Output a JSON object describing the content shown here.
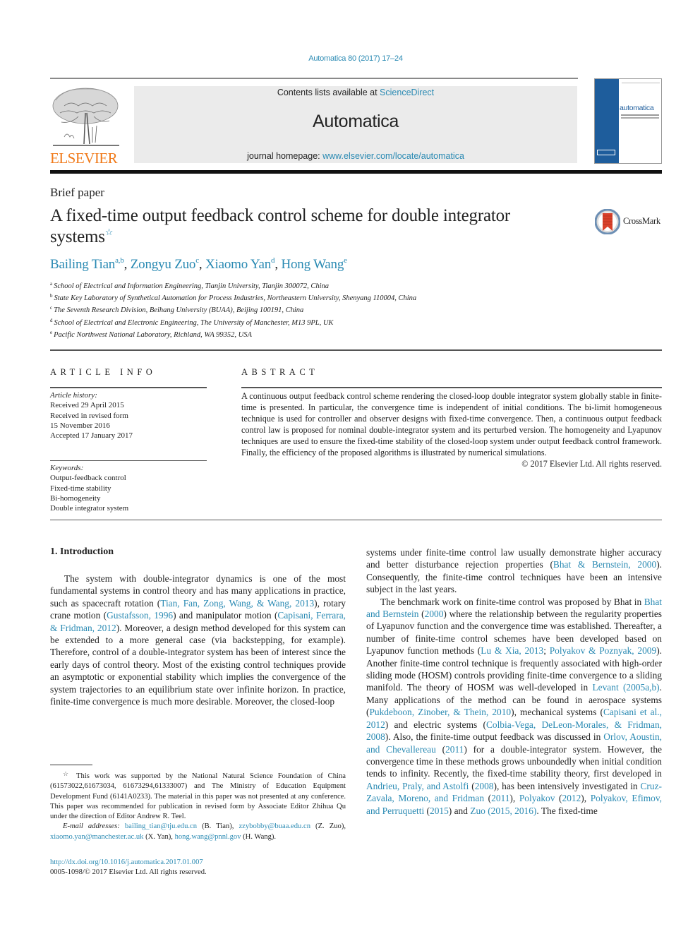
{
  "journal_ref": "Automatica 80 (2017) 17–24",
  "header": {
    "contents_prefix": "Contents lists available at ",
    "contents_link": "ScienceDirect",
    "journal_name": "Automatica",
    "homepage_prefix": "journal homepage: ",
    "homepage_link": "www.elsevier.com/locate/automatica",
    "publisher_logo_text": "ELSEVIER",
    "cover_title": "automatica"
  },
  "article": {
    "type": "Brief paper",
    "title": "A fixed-time output feedback control scheme for double integrator systems",
    "title_note_mark": "☆",
    "crossmark_label": "CrossMark",
    "authors": [
      {
        "name": "Bailing Tian",
        "aff": "a,b"
      },
      {
        "name": "Zongyu Zuo",
        "aff": "c"
      },
      {
        "name": "Xiaomo Yan",
        "aff": "d"
      },
      {
        "name": "Hong Wang",
        "aff": "e"
      }
    ],
    "affiliations": [
      {
        "mark": "a",
        "text": "School of Electrical and Information Engineering, Tianjin University, Tianjin 300072, China"
      },
      {
        "mark": "b",
        "text": "State Key Laboratory of Synthetical Automation for Process Industries, Northeastern University, Shenyang 110004, China"
      },
      {
        "mark": "c",
        "text": "The Seventh Research Division, Beihang University (BUAA), Beijing 100191, China"
      },
      {
        "mark": "d",
        "text": "School of Electrical and Electronic Engineering, The University of Manchester, M13 9PL, UK"
      },
      {
        "mark": "e",
        "text": "Pacific Northwest National Laboratory, Richland, WA 99352, USA"
      }
    ]
  },
  "article_info": {
    "heading": "ARTICLE INFO",
    "history_label": "Article history:",
    "history": [
      "Received 29 April 2015",
      "Received in revised form",
      "15 November 2016",
      "Accepted 17 January 2017"
    ],
    "keywords_label": "Keywords:",
    "keywords": [
      "Output-feedback control",
      "Fixed-time stability",
      "Bi-homogeneity",
      "Double integrator system"
    ]
  },
  "abstract": {
    "heading": "ABSTRACT",
    "text": "A continuous output feedback control scheme rendering the closed-loop double integrator system globally stable in finite-time is presented. In particular, the convergence time is independent of initial conditions. The bi-limit homogeneous technique is used for controller and observer designs with fixed-time convergence. Then, a continuous output feedback control law is proposed for nominal double-integrator system and its perturbed version. The homogeneity and Lyapunov techniques are used to ensure the fixed-time stability of the closed-loop system under output feedback control framework. Finally, the efficiency of the proposed algorithms is illustrated by numerical simulations.",
    "copyright": "© 2017 Elsevier Ltd. All rights reserved."
  },
  "introduction": {
    "heading": "1.  Introduction",
    "left": {
      "t1": "The system with double-integrator dynamics is one of the most fundamental systems in control theory and has many applications in practice, such as spacecraft rotation (",
      "c1": "Tian, Fan, Zong, Wang, & Wang, 2013",
      "t2": "), rotary crane motion (",
      "c2": "Gustafsson, 1996",
      "t3": ") and manipulator motion (",
      "c3": "Capisani, Ferrara, & Fridman, 2012",
      "t4": "). Moreover, a design method developed for this system can be extended to a more general case (via backstepping, for example). Therefore, control of a double-integrator system has been of interest since the early days of control theory. Most of the existing control techniques provide an asymptotic or exponential stability which implies the convergence of the system trajectories to an equilibrium state over infinite horizon. In practice, finite-time convergence is much more desirable. Moreover, the closed-loop"
    },
    "right_p1": {
      "t1": "systems under finite-time control law usually demonstrate higher accuracy and better disturbance rejection properties (",
      "c1": "Bhat & Bernstein, 2000",
      "t2": "). Consequently, the finite-time control techniques have been an intensive subject in the last years."
    },
    "right_p2": {
      "t1": "The benchmark work on finite-time control was proposed by Bhat in ",
      "c1": "Bhat and Bernstein",
      "t2": " (",
      "c2": "2000",
      "t3": ") where the relationship between the regularity properties of Lyapunov function and the convergence time was established. Thereafter, a number of finite-time control schemes have been developed based on Lyapunov function methods (",
      "c3": "Lu & Xia, 2013",
      "t4": "; ",
      "c4": "Polyakov & Poznyak, 2009",
      "t5": "). Another finite-time control technique is frequently associated with high-order sliding mode (HOSM) controls providing finite-time convergence to a sliding manifold. The theory of HOSM was well-developed in ",
      "c5": "Levant (2005a,b)",
      "t6": ". Many applications of the method can be found in aerospace systems (",
      "c6": "Pukdeboon, Zinober, & Thein, 2010",
      "t7": "), mechanical systems (",
      "c7": "Capisani et al., 2012",
      "t8": ") and electric systems (",
      "c8": "Colbia-Vega, DeLeon-Morales, & Fridman, 2008",
      "t9": "). Also, the finite-time output feedback was discussed in ",
      "c9": "Orlov, Aoustin, and Chevallereau",
      "t10": " (",
      "c10": "2011",
      "t11": ") for a double-integrator system. However, the convergence time in these methods grows unboundedly when initial condition tends to infinity. Recently, the fixed-time stability theory, first developed in ",
      "c11": "Andrieu, Praly, and Astolfi",
      "t12": " (",
      "c12": "2008",
      "t13": "), has been intensively investigated in ",
      "c13": "Cruz-Zavala, Moreno, and Fridman",
      "t14": " (",
      "c14": "2011",
      "t15": "), ",
      "c15": "Polyakov",
      "t16": " (",
      "c16": "2012",
      "t17": "), ",
      "c17": "Polyakov, Efimov, and Perruquetti",
      "t18": " (",
      "c18": "2015",
      "t19": ") and ",
      "c19": "Zuo (2015, 2016)",
      "t20": ". The fixed-time"
    }
  },
  "footnote": {
    "mark": "☆",
    "text": "This work was supported by the National Natural Science Foundation of China (61573022,61673034, 61673294,61333007) and The Ministry of Education Equipment Development Fund (6141A0233). The material in this paper was not presented at any conference. This paper was recommended for publication in revised form by Associate Editor Zhihua Qu under the direction of Editor Andrew R. Teel.",
    "email_label": "E-mail addresses:",
    "emails": [
      {
        "addr": "bailing_tian@tju.edu.cn",
        "who": " (B. Tian), "
      },
      {
        "addr": "zzybobby@buaa.edu.cn",
        "who": " (Z. Zuo), "
      },
      {
        "addr": "xiaomo.yan@manchester.ac.uk",
        "who": " (X. Yan), "
      },
      {
        "addr": "hong.wang@pnnl.gov",
        "who": " (H. Wang)."
      }
    ]
  },
  "footer": {
    "doi": "http://dx.doi.org/10.1016/j.automatica.2017.01.007",
    "issn_rights": "0005-1098/© 2017 Elsevier Ltd. All rights reserved."
  },
  "colors": {
    "link": "#2a8ab3",
    "elsevier_orange": "#f07a1a",
    "cover_blue": "#1e5d9c",
    "crossmark_red": "#d9412b"
  }
}
